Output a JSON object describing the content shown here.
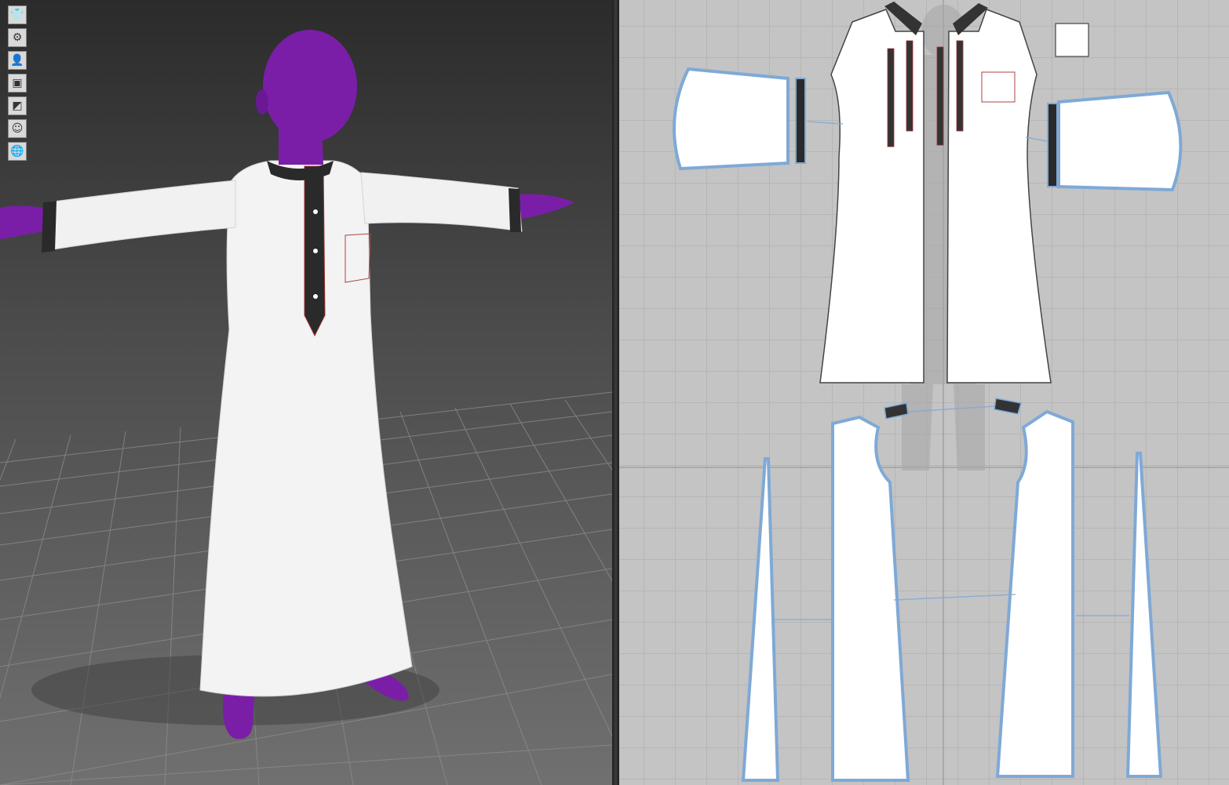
{
  "app": {
    "panes": [
      "3d-avatar-view",
      "2d-pattern-view"
    ]
  },
  "toolbar": {
    "items": [
      {
        "icon": "garment-icon",
        "glyph": "👕"
      },
      {
        "icon": "particle-icon",
        "glyph": "⚙"
      },
      {
        "icon": "avatar-icon",
        "glyph": "👤"
      },
      {
        "icon": "texture-icon",
        "glyph": "▣"
      },
      {
        "icon": "shading-icon",
        "glyph": "◩"
      },
      {
        "icon": "skin-icon",
        "glyph": "☺"
      },
      {
        "icon": "environment-icon",
        "glyph": "🌐"
      }
    ]
  },
  "colors": {
    "avatar": "#7a1ea8",
    "garment": "#f4f4f4",
    "trim": "#2a2a2a",
    "pattern_outline": "#7fa9d6",
    "grid": "#b6b6b6"
  }
}
